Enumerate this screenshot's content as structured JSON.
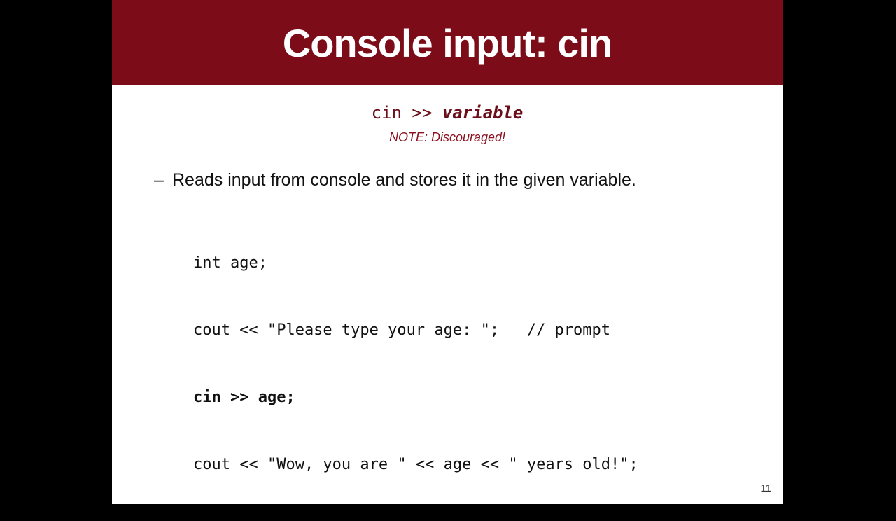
{
  "slide": {
    "title": "Console input: cin",
    "syntax": {
      "keyword": "cin >> ",
      "variable": "variable"
    },
    "note": "NOTE: Discouraged!",
    "bullet": {
      "dash": "–",
      "text": "Reads input from console and stores it in the given variable."
    },
    "code_lines": [
      "int age;",
      "cout << \"Please type your age: \";   // prompt",
      "cin >> age;",
      "cout << \"Wow, you are \" << age << \" years old!\";"
    ],
    "page_number": "11"
  },
  "colors": {
    "title_bar": "#7b0c18",
    "accent_text": "#6a0f1a",
    "background_outside": "#000000"
  }
}
